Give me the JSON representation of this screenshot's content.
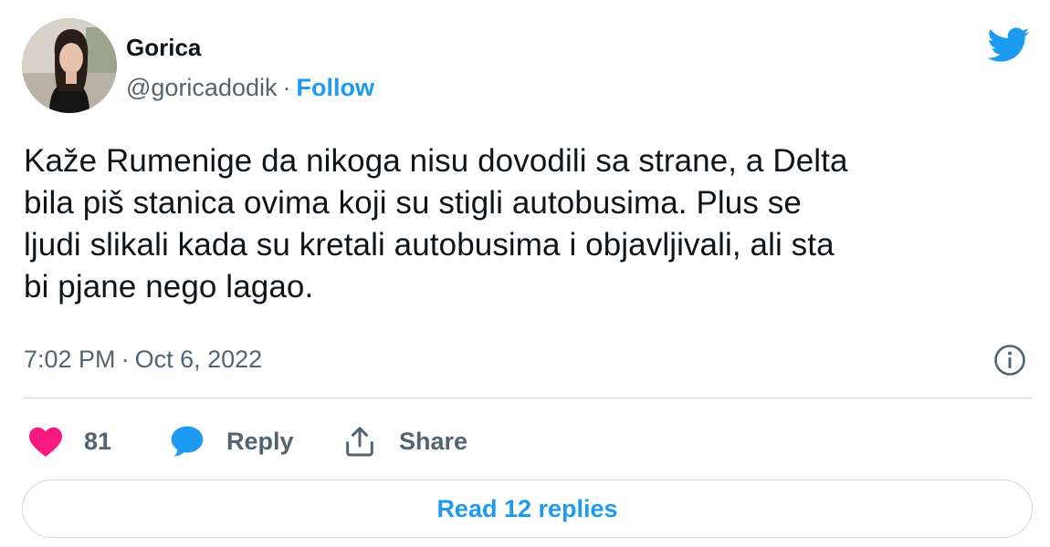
{
  "author": {
    "name": "Gorica",
    "handle": "@goricadodik",
    "separator": "·",
    "follow_label": "Follow"
  },
  "tweet": {
    "text": "Kaže Rumenige da nikoga nisu dovodili sa strane, a Delta\nbila piš stanica ovima koji su stigli autobusima. Plus se\nljudi slikali kada su kretali autobusima i objavljivali, ali sta\nbi pjane nego lagao.",
    "time": "7:02 PM",
    "separator": "·",
    "date": "Oct 6, 2022"
  },
  "actions": {
    "like_count": "81",
    "reply_label": "Reply",
    "share_label": "Share"
  },
  "read_replies_label": "Read 12 replies",
  "icons": {
    "brand": "twitter-bird-icon",
    "info": "info-icon",
    "like": "heart-icon",
    "reply": "speech-bubble-icon",
    "share": "share-icon"
  },
  "colors": {
    "accent": "#1d9bf0",
    "heart": "#f91880",
    "text": "#0f1419",
    "secondary_text": "#536471",
    "border": "#cfd9de"
  }
}
